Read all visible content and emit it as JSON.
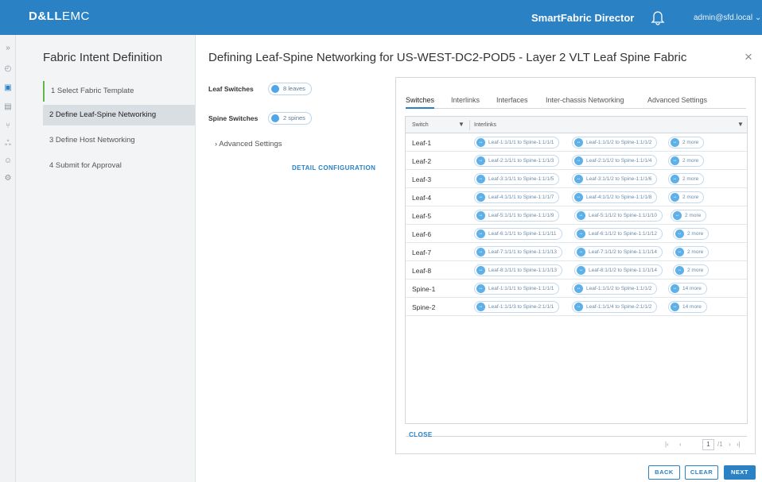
{
  "header": {
    "logo_bold": "D&LL",
    "logo_rest": "EMC",
    "app_title": "SmartFabric Director",
    "user": "admin@sfd.local ⌄"
  },
  "rail": {
    "icons": [
      "expand-icon",
      "dashboard-icon",
      "fabric-icon",
      "topology-icon",
      "network-icon",
      "hosts-icon",
      "users-icon",
      "settings-icon"
    ]
  },
  "steps": {
    "title": "Fabric Intent Definition",
    "items": [
      {
        "label": "1  Select Fabric Template"
      },
      {
        "label": "2  Define Leaf-Spine Networking"
      },
      {
        "label": "3  Define Host Networking"
      },
      {
        "label": "4  Submit for Approval"
      }
    ]
  },
  "main": {
    "title": "Defining Leaf-Spine Networking for US-WEST-DC2-POD5 - Layer 2 VLT Leaf Spine Fabric",
    "close_glyph": "×",
    "leaf_label": "Leaf Switches",
    "leaf_pill": "8 leaves",
    "spine_label": "Spine Switches",
    "spine_pill": "2 spines",
    "advanced": "›  Advanced Settings",
    "detail_link": "DETAIL CONFIGURATION"
  },
  "panel": {
    "tabs": [
      "Switches",
      "Interlinks",
      "Interfaces",
      "Inter-chassis Networking",
      "Advanced Settings"
    ],
    "columns": {
      "switch": "Switch",
      "interlinks": "Interlinks"
    },
    "rows": [
      {
        "switch": "Leaf-1",
        "links": [
          "Leaf-1:1/1/1 to Spine-1:1/1/1",
          "Leaf-1:1/1/2 to Spine-1:1/1/2"
        ],
        "more": "2 more"
      },
      {
        "switch": "Leaf-2",
        "links": [
          "Leaf-2:1/1/1 to Spine-1:1/1/3",
          "Leaf-2:1/1/2 to Spine-1:1/1/4"
        ],
        "more": "2 more"
      },
      {
        "switch": "Leaf-3",
        "links": [
          "Leaf-3:1/1/1 to Spine-1:1/1/5",
          "Leaf-3:1/1/2 to Spine-1:1/1/6"
        ],
        "more": "2 more"
      },
      {
        "switch": "Leaf-4",
        "links": [
          "Leaf-4:1/1/1 to Spine-1:1/1/7",
          "Leaf-4:1/1/2 to Spine-1:1/1/8"
        ],
        "more": "2 more"
      },
      {
        "switch": "Leaf-5",
        "links": [
          "Leaf-5:1/1/1 to Spine-1:1/1/9",
          "Leaf-5:1/1/2 to Spine-1:1/1/10"
        ],
        "more": "2 more"
      },
      {
        "switch": "Leaf-6",
        "links": [
          "Leaf-6:1/1/1 to Spine-1:1/1/11",
          "Leaf-6:1/1/2 to Spine-1:1/1/12"
        ],
        "more": "2 more"
      },
      {
        "switch": "Leaf-7",
        "links": [
          "Leaf-7:1/1/1 to Spine-1:1/1/13",
          "Leaf-7:1/1/2 to Spine-1:1/1/14"
        ],
        "more": "2 more"
      },
      {
        "switch": "Leaf-8",
        "links": [
          "Leaf-8:1/1/1 to Spine-1:1/1/13",
          "Leaf-8:1/1/2 to Spine-1:1/1/14"
        ],
        "more": "2 more"
      },
      {
        "switch": "Spine-1",
        "links": [
          "Leaf-1:1/1/1 to Spine-1:1/1/1",
          "Leaf-1:1/1/2 to Spine-1:1/1/2"
        ],
        "more": "14 more"
      },
      {
        "switch": "Spine-2",
        "links": [
          "Leaf-1:1/1/3 to Spine-2:1/1/1",
          "Leaf-1:1/1/4 to Spine-2:1/1/2"
        ],
        "more": "14 more"
      }
    ],
    "pager": {
      "first": "|‹",
      "prev": "‹",
      "page": "1",
      "total": "/1",
      "next": "›",
      "last": "›|"
    },
    "close": "CLOSE"
  },
  "footer": {
    "back": "BACK",
    "clear": "CLEAR",
    "next": "NEXT"
  },
  "colors": {
    "brand": "#2a81c4",
    "step_done": "#64b64a"
  }
}
